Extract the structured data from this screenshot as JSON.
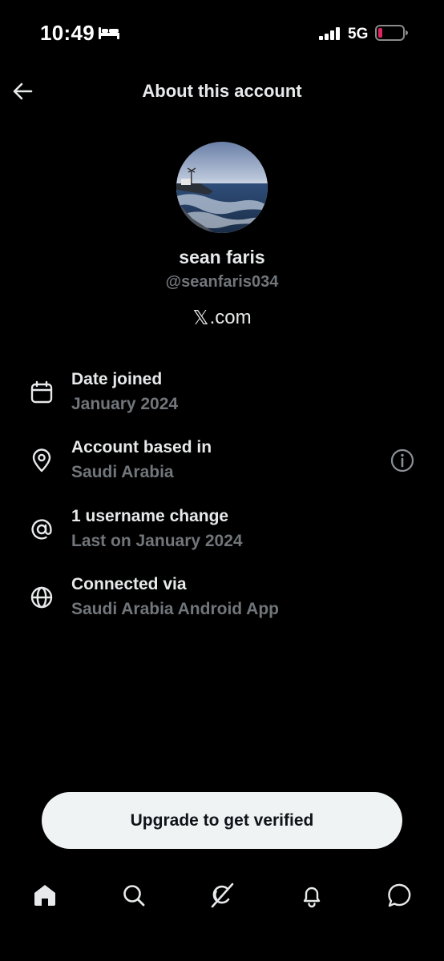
{
  "status_bar": {
    "time": "10:49",
    "network": "5G",
    "icons": [
      "bed-icon",
      "signal-icon",
      "battery-low-icon"
    ]
  },
  "header": {
    "title": "About this account",
    "back_icon": "back-arrow-icon"
  },
  "profile": {
    "display_name": "sean faris",
    "handle": "@seanfaris034",
    "site_logo": "𝕏",
    "site_text": ".com"
  },
  "info": [
    {
      "icon": "calendar-icon",
      "title": "Date joined",
      "subtitle": "January 2024"
    },
    {
      "icon": "location-pin-icon",
      "title": "Account based in",
      "subtitle": "Saudi Arabia",
      "help_icon": "info-circle-icon"
    },
    {
      "icon": "at-sign-icon",
      "title": "1 username change",
      "subtitle": "Last on January 2024"
    },
    {
      "icon": "globe-icon",
      "title": "Connected via",
      "subtitle": "Saudi Arabia Android App"
    }
  ],
  "upgrade_button": {
    "label": "Upgrade to get verified"
  },
  "bottom_nav": {
    "items": [
      "home-icon",
      "search-icon",
      "grok-icon",
      "notifications-bell-icon",
      "messages-icon"
    ],
    "active": "home-icon"
  },
  "colors": {
    "background": "#000000",
    "primary_text": "#e7e9ea",
    "secondary_text": "#71767b",
    "button_bg": "#eff3f4",
    "button_text": "#0f1419",
    "battery_low": "#e0245e"
  }
}
